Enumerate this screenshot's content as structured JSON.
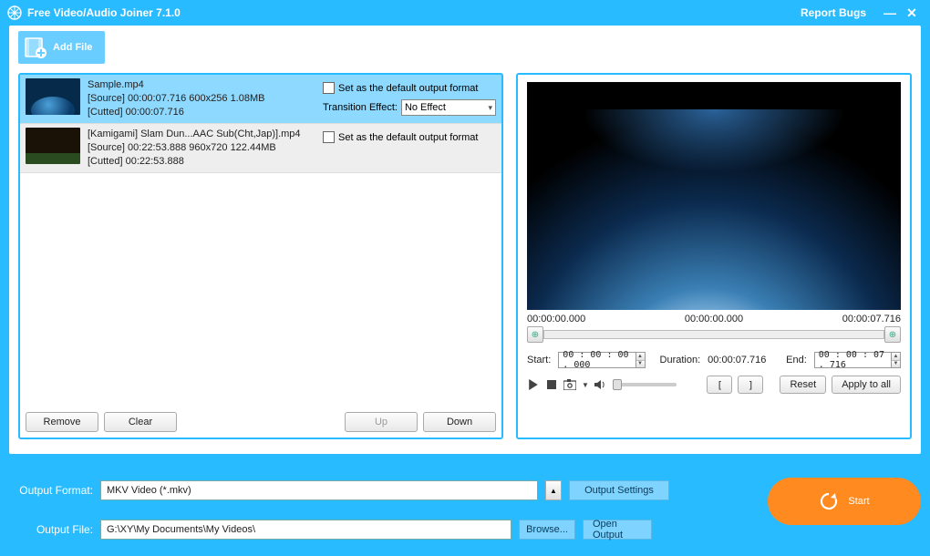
{
  "window": {
    "title": "Free Video/Audio Joiner 7.1.0",
    "report_bugs": "Report Bugs"
  },
  "toolbar": {
    "add_file": "Add File"
  },
  "files": [
    {
      "name": "Sample.mp4",
      "source_line": "[Source]  00:00:07.716  600x256  1.08MB",
      "cutted_line": "[Cutted]  00:00:07.716",
      "set_default_label": "Set as the default output format",
      "transition_label": "Transition Effect:",
      "transition_value": "No Effect",
      "selected": true
    },
    {
      "name": "[Kamigami] Slam Dun...AAC Sub(Cht,Jap)].mp4",
      "source_line": "[Source]  00:22:53.888  960x720  122.44MB",
      "cutted_line": "[Cutted]  00:22:53.888",
      "set_default_label": "Set as the default output format",
      "selected": false
    }
  ],
  "list_buttons": {
    "remove": "Remove",
    "clear": "Clear",
    "up": "Up",
    "down": "Down"
  },
  "preview": {
    "time_left": "00:00:00.000",
    "time_mid": "00:00:00.000",
    "time_right": "00:00:07.716",
    "start_label": "Start:",
    "start_value": "00 : 00 : 00 . 000",
    "duration_label": "Duration:",
    "duration_value": "00:00:07.716",
    "end_label": "End:",
    "end_value": "00 : 00 : 07 . 716",
    "reset": "Reset",
    "apply_all": "Apply to all"
  },
  "output": {
    "format_label": "Output Format:",
    "format_value": "MKV Video (*.mkv)",
    "settings": "Output Settings",
    "file_label": "Output File:",
    "file_value": "G:\\XY\\My Documents\\My Videos\\",
    "browse": "Browse...",
    "open": "Open Output",
    "start": "Start"
  }
}
